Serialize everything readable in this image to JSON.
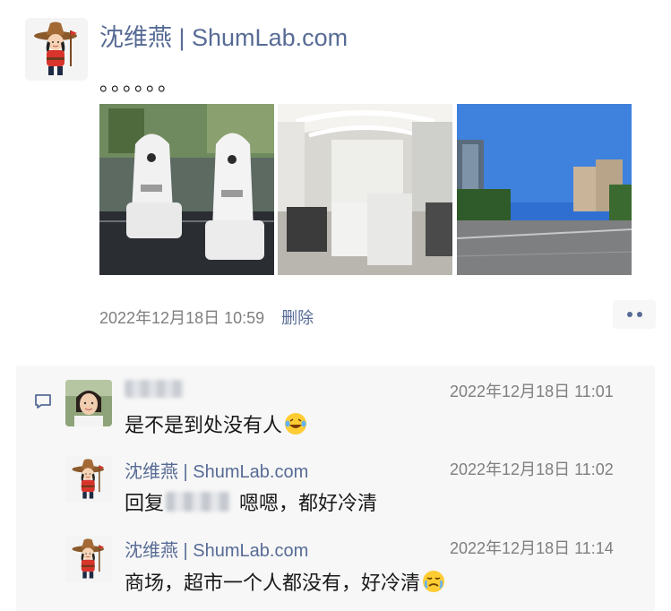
{
  "post": {
    "author": "沈维燕 | ShumLab.com",
    "text": "。。。。。。",
    "timestamp": "2022年12月18日 10:59",
    "delete_label": "删除",
    "photos": [
      "robots-photo",
      "office-lobby-photo",
      "empty-street-photo"
    ]
  },
  "comments": [
    {
      "author": "",
      "time": "2022年12月18日 11:01",
      "text": "是不是到处没有人",
      "emoji": "laughing-tears-emoji"
    },
    {
      "author": "沈维燕 | ShumLab.com",
      "time": "2022年12月18日 11:02",
      "reply_prefix": "回复",
      "text": "嗯嗯，都好冷清"
    },
    {
      "author": "沈维燕 | ShumLab.com",
      "time": "2022年12月18日 11:14",
      "text": "商场，超市一个人都没有，好冷清",
      "emoji": "crying-emoji"
    }
  ],
  "colors": {
    "link": "#576b95",
    "meta": "#7f7f7f",
    "comment_bg": "#f7f7f7"
  }
}
